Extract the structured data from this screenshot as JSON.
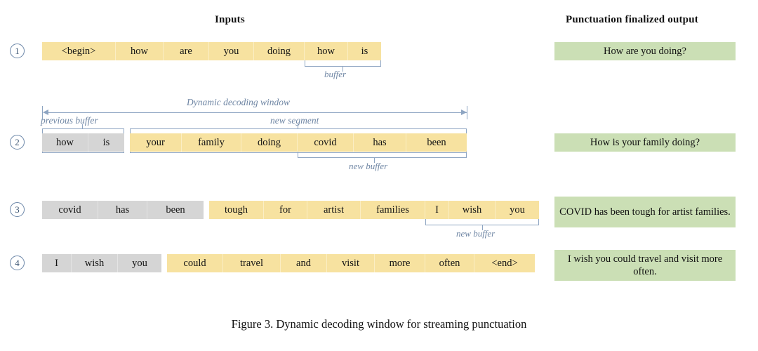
{
  "headers": {
    "inputs": "Inputs",
    "output": "Punctuation finalized output"
  },
  "colors": {
    "yellow_segment": "#f7e2a0",
    "gray_buffer": "#d5d5d5",
    "green_output": "#cbdfb5",
    "annotation_blue": "#8ea5c2",
    "step_circle": "#6b86a8"
  },
  "annotations": {
    "dynamic_decoding_window": "Dynamic decoding window",
    "previous_buffer": "previous buffer",
    "new_segment": "new segment",
    "buffer": "buffer",
    "new_buffer_row2": "new buffer",
    "new_buffer_row3": "new buffer"
  },
  "rows": [
    {
      "step": "1",
      "gray_tokens": [],
      "yellow_tokens": [
        "<begin>",
        "how",
        "are",
        "you",
        "doing",
        "how",
        "is"
      ],
      "buffer_label": "buffer",
      "buffer_tokens": [
        "how",
        "is"
      ],
      "output": "How are you doing?"
    },
    {
      "step": "2",
      "gray_tokens": [
        "how",
        "is"
      ],
      "yellow_tokens": [
        "your",
        "family",
        "doing",
        "covid",
        "has",
        "been"
      ],
      "buffer_label": "new buffer",
      "buffer_tokens": [
        "covid",
        "has",
        "been"
      ],
      "output": "How is your family doing?"
    },
    {
      "step": "3",
      "gray_tokens": [
        "covid",
        "has",
        "been"
      ],
      "yellow_tokens": [
        "tough",
        "for",
        "artist",
        "families",
        "I",
        "wish",
        "you"
      ],
      "buffer_label": "new buffer",
      "buffer_tokens": [
        "I",
        "wish",
        "you"
      ],
      "output": "COVID has been tough for artist families."
    },
    {
      "step": "4",
      "gray_tokens": [
        "I",
        "wish",
        "you"
      ],
      "yellow_tokens": [
        "could",
        "travel",
        "and",
        "visit",
        "more",
        "often",
        "<end>"
      ],
      "buffer_label": "",
      "buffer_tokens": [],
      "output": "I wish you could travel and visit more often."
    }
  ],
  "caption": "Figure 3. Dynamic decoding window for streaming punctuation"
}
